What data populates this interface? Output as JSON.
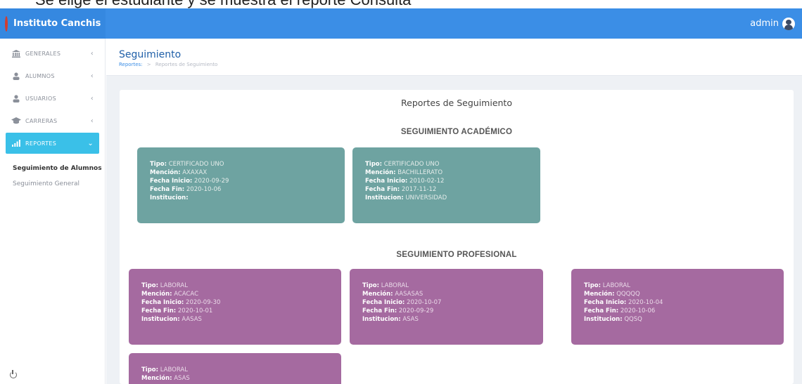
{
  "caption": "Se elige el estudiante y se muestra el reporte  Consulta",
  "topbar": {
    "brand_name": "Instituto Canchis",
    "user_name": "admin"
  },
  "sidebar": {
    "items": [
      {
        "label": "GENERALES",
        "icon": "building-icon",
        "chevron": "‹"
      },
      {
        "label": "ALUMNOS",
        "icon": "user-icon",
        "chevron": "‹"
      },
      {
        "label": "USUARIOS",
        "icon": "user-icon",
        "chevron": "‹"
      },
      {
        "label": "CARRERAS",
        "icon": "graduation-cap-icon",
        "chevron": "‹"
      },
      {
        "label": "REPORTES",
        "icon": "signal-bars-icon",
        "chevron": "⌄"
      }
    ],
    "subitems": [
      {
        "label": "Seguimiento de Alumnos"
      },
      {
        "label": "Seguimiento General"
      }
    ],
    "active_color": "#3ac0e8"
  },
  "header": {
    "title": "Seguimiento",
    "breadcrumb_link": "Reportes:",
    "breadcrumb_sep": ">",
    "breadcrumb_current": "Reportes de Seguimiento"
  },
  "panel": {
    "title": "Reportes de Seguimiento",
    "academic_heading": "SEGUIMIENTO ACADÉMICO",
    "professional_heading": "SEGUIMIENTO PROFESIONAL"
  },
  "field_labels": {
    "tipo": "Tipo:",
    "mencion": "Mención:",
    "inicio": "Fecha Inicio:",
    "fin": "Fecha Fin:",
    "institucion": "Institucion:"
  },
  "academic_cards": [
    {
      "tipo": "CERTIFICADO UNO",
      "mencion": "AXAXAX",
      "inicio": "2020-09-29",
      "fin": "2020-10-06",
      "institucion": ""
    },
    {
      "tipo": "CERTIFICADO UNO",
      "mencion": "BACHILLERATO",
      "inicio": "2010-02-12",
      "fin": "2017-11-12",
      "institucion": "UNIVERSIDAD"
    }
  ],
  "professional_cards": [
    {
      "tipo": "LABORAL",
      "mencion": "ACACAC",
      "inicio": "2020-09-30",
      "fin": "2020-10-01",
      "institucion": "AASAS"
    },
    {
      "tipo": "LABORAL",
      "mencion": "AASASAS",
      "inicio": "2020-10-07",
      "fin": "2020-09-29",
      "institucion": "ASAS"
    },
    {
      "tipo": "LABORAL",
      "mencion": "QQQQQ",
      "inicio": "2020-10-04",
      "fin": "2020-10-06",
      "institucion": "QQSQ"
    },
    {
      "tipo": "LABORAL",
      "mencion": "ASAS",
      "inicio": "",
      "fin": "",
      "institucion": ""
    }
  ],
  "colors": {
    "topbar": "#3b8ee6",
    "academic_card": "#6ea3a1",
    "professional_card": "#a56aa0"
  }
}
